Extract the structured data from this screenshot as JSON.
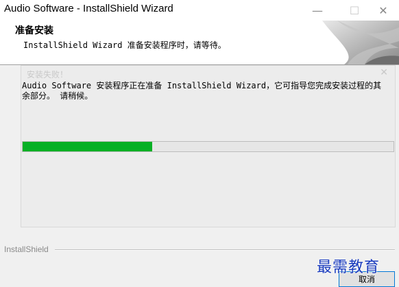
{
  "window": {
    "title": "Audio Software - InstallShield Wizard",
    "minimize_glyph": "—",
    "maximize_glyph": "☐",
    "close_glyph": "✕"
  },
  "header": {
    "title": "准备安装",
    "subtitle": "InstallShield Wizard 准备安装程序时，请等待。"
  },
  "background_dialog": {
    "title": "安装失败！",
    "close_glyph": "✕"
  },
  "body": {
    "message": "Audio Software 安装程序正在准备 InstallShield Wizard，它可指导您完成安装过程的其余部分。 请稍候。"
  },
  "progress": {
    "fraction": 0.35,
    "color": "#06b025"
  },
  "footer": {
    "label": "InstallShield",
    "cancel_label": "取消"
  },
  "watermark": "最需教育"
}
